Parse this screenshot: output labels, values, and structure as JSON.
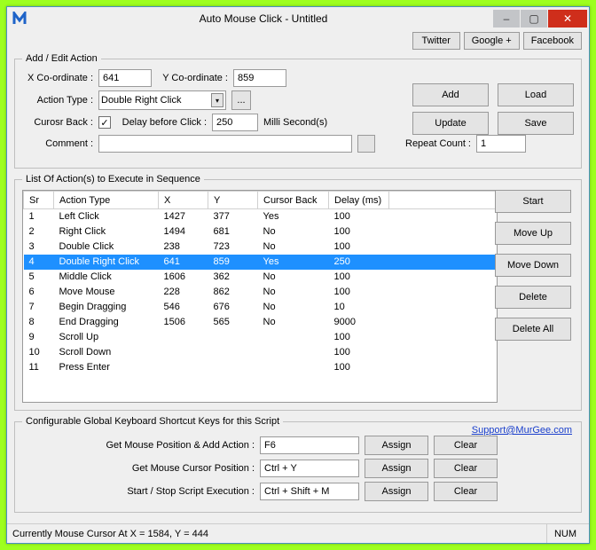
{
  "window": {
    "title": "Auto Mouse Click - Untitled"
  },
  "social": {
    "twitter": "Twitter",
    "google": "Google +",
    "facebook": "Facebook"
  },
  "addedit": {
    "legend": "Add / Edit Action",
    "xLabel": "X Co-ordinate :",
    "xValue": "641",
    "yLabel": "Y Co-ordinate :",
    "yValue": "859",
    "actionTypeLabel": "Action Type :",
    "actionTypeValue": "Double Right Click",
    "cursorBackLabel": "Curosr Back :",
    "cursorBackChecked": "✓",
    "delayBeforeLabel": "Delay before Click :",
    "delayValue": "250",
    "msLabel": "Milli Second(s)",
    "commentLabel": "Comment :",
    "commentValue": "",
    "repeatLabel": "Repeat Count :",
    "repeatValue": "1",
    "addBtn": "Add",
    "loadBtn": "Load",
    "updateBtn": "Update",
    "saveBtn": "Save"
  },
  "list": {
    "legend": "List Of Action(s) to Execute in Sequence",
    "headers": {
      "sr": "Sr",
      "type": "Action Type",
      "x": "X",
      "y": "Y",
      "cursor": "Cursor Back",
      "delay": "Delay (ms)"
    },
    "startBtn": "Start",
    "moveUpBtn": "Move Up",
    "moveDownBtn": "Move Down",
    "deleteBtn": "Delete",
    "deleteAllBtn": "Delete All",
    "rows": [
      {
        "sr": "1",
        "type": "Left Click",
        "x": "1427",
        "y": "377",
        "cursor": "Yes",
        "delay": "100"
      },
      {
        "sr": "2",
        "type": "Right Click",
        "x": "1494",
        "y": "681",
        "cursor": "No",
        "delay": "100"
      },
      {
        "sr": "3",
        "type": "Double Click",
        "x": "238",
        "y": "723",
        "cursor": "No",
        "delay": "100"
      },
      {
        "sr": "4",
        "type": "Double Right Click",
        "x": "641",
        "y": "859",
        "cursor": "Yes",
        "delay": "250",
        "selected": true
      },
      {
        "sr": "5",
        "type": "Middle Click",
        "x": "1606",
        "y": "362",
        "cursor": "No",
        "delay": "100"
      },
      {
        "sr": "6",
        "type": "Move Mouse",
        "x": "228",
        "y": "862",
        "cursor": "No",
        "delay": "100"
      },
      {
        "sr": "7",
        "type": "Begin Dragging",
        "x": "546",
        "y": "676",
        "cursor": "No",
        "delay": "10"
      },
      {
        "sr": "8",
        "type": "End Dragging",
        "x": "1506",
        "y": "565",
        "cursor": "No",
        "delay": "9000"
      },
      {
        "sr": "9",
        "type": "Scroll Up",
        "x": "",
        "y": "",
        "cursor": "",
        "delay": "100"
      },
      {
        "sr": "10",
        "type": "Scroll Down",
        "x": "",
        "y": "",
        "cursor": "",
        "delay": "100"
      },
      {
        "sr": "11",
        "type": "Press Enter",
        "x": "",
        "y": "",
        "cursor": "",
        "delay": "100"
      }
    ]
  },
  "hotkeys": {
    "legend": "Configurable Global Keyboard Shortcut Keys for this Script",
    "support": "Support@MurGee.com",
    "addActionLabel": "Get Mouse Position & Add Action :",
    "addActionValue": "F6",
    "cursorPosLabel": "Get Mouse Cursor Position :",
    "cursorPosValue": "Ctrl + Y",
    "startStopLabel": "Start / Stop Script Execution :",
    "startStopValue": "Ctrl + Shift + M",
    "assign": "Assign",
    "clear": "Clear"
  },
  "status": {
    "pos": "Currently Mouse Cursor At X = 1584, Y = 444",
    "num": "NUM"
  }
}
